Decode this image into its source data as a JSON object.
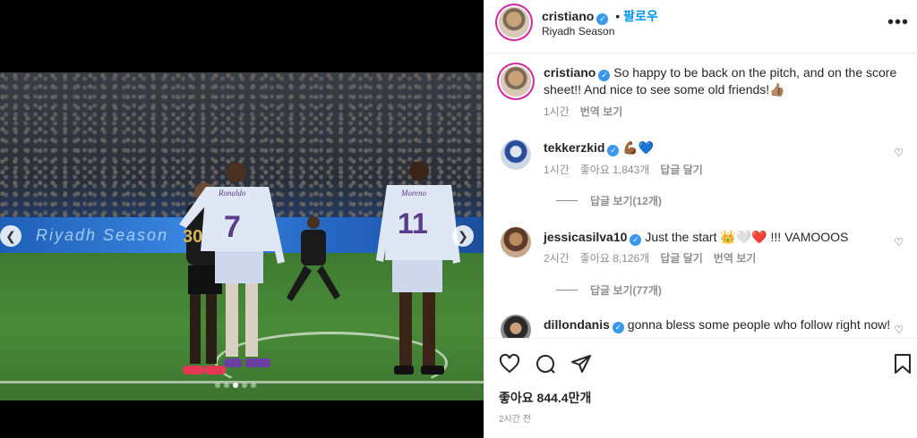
{
  "post": {
    "username": "cristiano",
    "follow_label": "팔로우",
    "dot": "•",
    "location": "Riyadh Season",
    "caption": "So happy to be back on the pitch, and on the score sheet!! And nice to see some old friends!👍🏽",
    "caption_time": "1시간",
    "translate_label": "번역 보기",
    "board_text": "Riyadh Season",
    "jersey_7_name": "Ronaldo",
    "jersey_7": "7",
    "jersey_11_name": "Moreno",
    "jersey_11": "11",
    "jersey_30": "30",
    "image_dots": 5,
    "active_dot": 2
  },
  "comments": [
    {
      "username": "tekkerzkid",
      "text": "💪🏾💙",
      "time": "1시간",
      "likes": "좋아요 1,843개",
      "reply_label": "답글 달기",
      "translate_label": "",
      "view_replies": "답글 보기(12개)"
    },
    {
      "username": "jessicasilva10",
      "text": "Just the start 👑🤍❤️ !!! VAMOOOS",
      "time": "2시간",
      "likes": "좋아요 8,126개",
      "reply_label": "답글 달기",
      "translate_label": "번역 보기",
      "view_replies": "답글 보기(77개)"
    },
    {
      "username": "dillondanis",
      "text": "gonna bless some people who follow right now!",
      "time": "",
      "likes": "",
      "reply_label": "",
      "translate_label": "",
      "view_replies": ""
    }
  ],
  "footer": {
    "likes": "좋아요 844.4만개",
    "time_ago": "2시간 전"
  },
  "icons": {
    "verified": "verified-badge-icon",
    "more": "more-options-icon",
    "like": "heart-icon",
    "comment": "comment-icon",
    "share": "share-icon",
    "save": "bookmark-icon",
    "prev": "chevron-left-icon",
    "next": "chevron-right-icon"
  },
  "colors": {
    "accent": "#0095f6",
    "verified": "#3897f0",
    "muted": "#8e8e8e"
  }
}
